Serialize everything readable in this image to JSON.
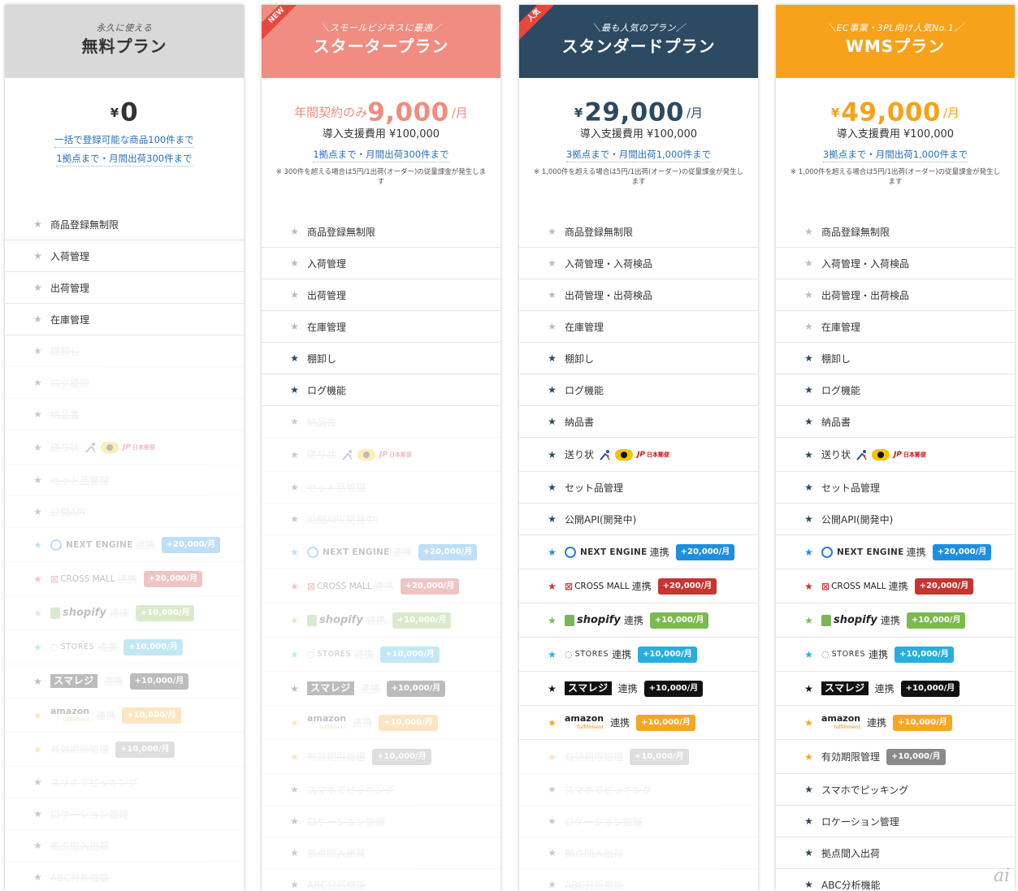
{
  "colors": {
    "free_header": "#d9d9d9",
    "starter_header": "#f08c80",
    "standard_header": "#2c4a62",
    "wms_header": "#f6a21a",
    "ribbon_red": "#e8473c",
    "ne_badge": "#1e8fe0",
    "cm_badge": "#c8342f",
    "shopify_badge": "#7cb94e",
    "stores_badge": "#27aee0",
    "smaregi_badge": "#111111",
    "amazon_badge": "#f5a623",
    "expiry_badge": "#8a8a8a"
  },
  "plans": [
    {
      "key": "free",
      "tagline": "永久に使える",
      "name": "無料プラン",
      "ribbon": "",
      "price_prefix": "",
      "currency": "¥",
      "amount": "0",
      "unit": "",
      "setup_fee": "",
      "limits": [
        "一括で登録可能な商品100件まで",
        "1拠点まで・月間出荷300件まで"
      ],
      "note": "",
      "features": [
        {
          "text": "商品登録無制限",
          "active": true
        },
        {
          "text": "入荷管理",
          "active": true
        },
        {
          "text": "出荷管理",
          "active": true
        },
        {
          "text": "在庫管理",
          "active": true
        },
        {
          "text": "棚卸し",
          "active": false
        },
        {
          "text": "ログ機能",
          "active": false
        },
        {
          "text": "納品書",
          "active": false
        },
        {
          "text": "送り状",
          "active": false,
          "type": "carriers"
        },
        {
          "text": "セット品管理",
          "active": false
        },
        {
          "text": "公開API",
          "active": false
        },
        {
          "text": "連携",
          "active": false,
          "type": "ne",
          "badge": "+20,000/月"
        },
        {
          "text": "連携",
          "active": false,
          "type": "cm",
          "badge": "+20,000/月"
        },
        {
          "text": "連携",
          "active": false,
          "type": "shopify",
          "badge": "+10,000/月"
        },
        {
          "text": "連携",
          "active": false,
          "type": "stores",
          "badge": "+10,000/月"
        },
        {
          "text": "連携",
          "active": false,
          "type": "smaregi",
          "badge": "+10,000/月"
        },
        {
          "text": "連携",
          "active": false,
          "type": "amazon",
          "badge": "+10,000/月"
        },
        {
          "text": "有効期限管理",
          "active": false,
          "type": "expiry",
          "badge": "+10,000/月"
        },
        {
          "text": "スマホでピッキング",
          "active": false
        },
        {
          "text": "ロケーション管理",
          "active": false
        },
        {
          "text": "拠点間入出荷",
          "active": false
        },
        {
          "text": "ABC分析機能",
          "active": false
        }
      ]
    },
    {
      "key": "starter",
      "tagline": "＼スモールビジネスに最適／",
      "name": "スタータープラン",
      "ribbon": "NEW",
      "price_prefix": "年間契約のみ",
      "currency": "",
      "amount": "9,000",
      "unit": "/月",
      "setup_fee": "導入支援費用 ¥100,000",
      "limits": [
        "1拠点まで・月間出荷300件まで"
      ],
      "note": "※ 300件を超える場合は5円/1出荷(オーダー)の従量課金が発生します",
      "features": [
        {
          "text": "商品登録無制限",
          "active": true
        },
        {
          "text": "入荷管理",
          "active": true
        },
        {
          "text": "出荷管理",
          "active": true
        },
        {
          "text": "在庫管理",
          "active": true
        },
        {
          "text": "棚卸し",
          "active": true
        },
        {
          "text": "ログ機能",
          "active": true
        },
        {
          "text": "納品書",
          "active": false
        },
        {
          "text": "送り状",
          "active": false,
          "type": "carriers"
        },
        {
          "text": "セット品管理",
          "active": false
        },
        {
          "text": "公開API(開発中)",
          "active": false
        },
        {
          "text": "連携",
          "active": false,
          "type": "ne",
          "badge": "+20,000/月"
        },
        {
          "text": "連携",
          "active": false,
          "type": "cm",
          "badge": "+20,000/月"
        },
        {
          "text": "連携",
          "active": false,
          "type": "shopify",
          "badge": "+10,000/月"
        },
        {
          "text": "連携",
          "active": false,
          "type": "stores",
          "badge": "+10,000/月"
        },
        {
          "text": "連携",
          "active": false,
          "type": "smaregi",
          "badge": "+10,000/月"
        },
        {
          "text": "連携",
          "active": false,
          "type": "amazon",
          "badge": "+10,000/月"
        },
        {
          "text": "有効期限管理",
          "active": false,
          "type": "expiry",
          "badge": "+10,000/月"
        },
        {
          "text": "スマホでピッキング",
          "active": false
        },
        {
          "text": "ロケーション管理",
          "active": false
        },
        {
          "text": "拠点間入出荷",
          "active": false
        },
        {
          "text": "ABC分析機能",
          "active": false
        }
      ]
    },
    {
      "key": "standard",
      "tagline": "＼最も人気のプラン／",
      "name": "スタンダードプラン",
      "ribbon": "人気",
      "price_prefix": "",
      "currency": "¥",
      "amount": "29,000",
      "unit": "/月",
      "setup_fee": "導入支援費用 ¥100,000",
      "limits": [
        "3拠点まで・月間出荷1,000件まで"
      ],
      "note": "※ 1,000件を超える場合は5円/1出荷(オーダー)の従量課金が発生します",
      "features": [
        {
          "text": "商品登録無制限",
          "active": true
        },
        {
          "text": "入荷管理・入荷検品",
          "active": true
        },
        {
          "text": "出荷管理・出荷検品",
          "active": true
        },
        {
          "text": "在庫管理",
          "active": true
        },
        {
          "text": "棚卸し",
          "active": true
        },
        {
          "text": "ログ機能",
          "active": true
        },
        {
          "text": "納品書",
          "active": true
        },
        {
          "text": "送り状",
          "active": true,
          "type": "carriers"
        },
        {
          "text": "セット品管理",
          "active": true
        },
        {
          "text": "公開API(開発中)",
          "active": true
        },
        {
          "text": "連携",
          "active": true,
          "type": "ne",
          "badge": "+20,000/月"
        },
        {
          "text": "連携",
          "active": true,
          "type": "cm",
          "badge": "+20,000/月"
        },
        {
          "text": "連携",
          "active": true,
          "type": "shopify",
          "badge": "+10,000/月"
        },
        {
          "text": "連携",
          "active": true,
          "type": "stores",
          "badge": "+10,000/月"
        },
        {
          "text": "連携",
          "active": true,
          "type": "smaregi",
          "badge": "+10,000/月"
        },
        {
          "text": "連携",
          "active": true,
          "type": "amazon",
          "badge": "+10,000/月"
        },
        {
          "text": "有効期限管理",
          "active": false,
          "type": "expiry",
          "badge": "+10,000/月"
        },
        {
          "text": "スマホでピッキング",
          "active": false
        },
        {
          "text": "ロケーション管理",
          "active": false
        },
        {
          "text": "拠点間入出荷",
          "active": false
        },
        {
          "text": "ABC分析機能",
          "active": false
        }
      ]
    },
    {
      "key": "wms",
      "tagline": "＼EC事業・3PL向け人気No.1／",
      "name": "WMSプラン",
      "ribbon": "",
      "price_prefix": "",
      "currency": "¥",
      "amount": "49,000",
      "unit": "/月",
      "setup_fee": "導入支援費用 ¥100,000",
      "limits": [
        "3拠点まで・月間出荷1,000件まで"
      ],
      "note": "※ 1,000件を超える場合は5円/1出荷(オーダー)の従量課金が発生します",
      "features": [
        {
          "text": "商品登録無制限",
          "active": true
        },
        {
          "text": "入荷管理・入荷検品",
          "active": true
        },
        {
          "text": "出荷管理・出荷検品",
          "active": true
        },
        {
          "text": "在庫管理",
          "active": true
        },
        {
          "text": "棚卸し",
          "active": true
        },
        {
          "text": "ログ機能",
          "active": true
        },
        {
          "text": "納品書",
          "active": true
        },
        {
          "text": "送り状",
          "active": true,
          "type": "carriers"
        },
        {
          "text": "セット品管理",
          "active": true
        },
        {
          "text": "公開API(開発中)",
          "active": true
        },
        {
          "text": "連携",
          "active": true,
          "type": "ne",
          "badge": "+20,000/月"
        },
        {
          "text": "連携",
          "active": true,
          "type": "cm",
          "badge": "+20,000/月"
        },
        {
          "text": "連携",
          "active": true,
          "type": "shopify",
          "badge": "+10,000/月"
        },
        {
          "text": "連携",
          "active": true,
          "type": "stores",
          "badge": "+10,000/月"
        },
        {
          "text": "連携",
          "active": true,
          "type": "smaregi",
          "badge": "+10,000/月"
        },
        {
          "text": "連携",
          "active": true,
          "type": "amazon",
          "badge": "+10,000/月"
        },
        {
          "text": "有効期限管理",
          "active": true,
          "type": "expiry",
          "badge": "+10,000/月"
        },
        {
          "text": "スマホでピッキング",
          "active": true
        },
        {
          "text": "ロケーション管理",
          "active": true
        },
        {
          "text": "拠点間入出荷",
          "active": true
        },
        {
          "text": "ABC分析機能",
          "active": true
        }
      ]
    }
  ],
  "logos": {
    "ne": "NEXT ENGINE",
    "cm_mark": "⊠",
    "cm": "CROSS MALL",
    "shopify": "shopify",
    "stores": "STORES",
    "smaregi": "スマレジ",
    "amazon": "amazon",
    "amazon_sub": "fulfillment",
    "jp_mark": "JP",
    "jp": "日本郵便"
  },
  "watermark": "ai"
}
